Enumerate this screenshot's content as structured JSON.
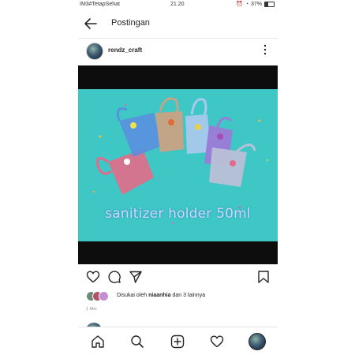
{
  "status_bar": {
    "carrier": "IM3#TetapSehat",
    "time": "21.20",
    "battery": "37%"
  },
  "header": {
    "title": "Postingan"
  },
  "post": {
    "username": "rendz_craft",
    "image_caption": "sanitizer holder 50ml",
    "liked_by_prefix": "Disukai oleh",
    "liked_by_user": "niaanhia",
    "liked_by_suffix": "dan 3 lainnya",
    "date": "1 Mei"
  },
  "icons": {
    "back": "back-arrow-icon",
    "more": "more-vertical-icon",
    "like": "heart-icon",
    "comment": "comment-icon",
    "share": "send-icon",
    "save": "bookmark-icon",
    "home": "home-icon",
    "search": "search-icon",
    "add": "add-post-icon",
    "activity": "heart-icon",
    "profile": "profile-avatar"
  },
  "colors": {
    "image_background": "#3ec7c4",
    "caption_text": "#c8dcff"
  }
}
